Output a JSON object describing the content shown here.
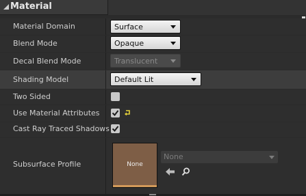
{
  "section": {
    "title": "Material"
  },
  "rows": [
    {
      "label": "Material Domain",
      "value": "Surface"
    },
    {
      "label": "Blend Mode",
      "value": "Opaque"
    },
    {
      "label": "Decal Blend Mode",
      "value": "Translucent"
    },
    {
      "label": "Shading Model",
      "value": "Default Lit"
    },
    {
      "label": "Two Sided",
      "checked": false
    },
    {
      "label": "Use Material Attributes",
      "checked": true
    },
    {
      "label": "Cast Ray Traced Shadows",
      "checked": true
    },
    {
      "label": "Subsurface Profile",
      "thumbnail_text": "None",
      "asset_value": "None"
    }
  ],
  "colors": {
    "panel_bg": "#2b2b2b",
    "header_bg": "#3a3a3a",
    "thumbnail": "#7e5e46",
    "reset_arrow": "#e6d23a"
  },
  "icons": [
    "collapse-arrow-icon",
    "checkmark-icon",
    "reset-to-default-icon",
    "use-selected-arrow-icon",
    "browse-magnifier-icon"
  ]
}
